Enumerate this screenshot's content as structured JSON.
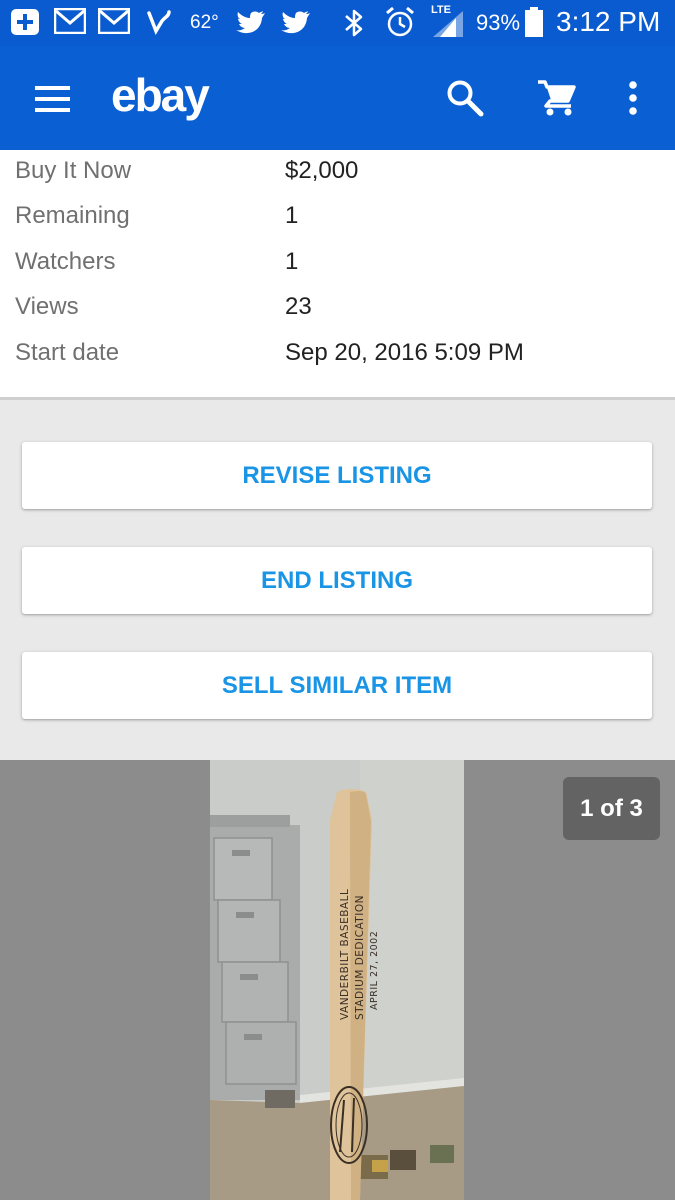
{
  "status_bar": {
    "temperature": "62°",
    "network": "LTE",
    "battery": "93%",
    "time": "3:12 PM",
    "icons": [
      "add-icon",
      "gmail-icon",
      "gmail-icon",
      "vine-icon",
      "twitter-icon",
      "twitter-icon",
      "bluetooth-icon",
      "alarm-icon",
      "signal-icon",
      "battery-icon"
    ]
  },
  "app_bar": {
    "logo": "ebay",
    "icons": [
      "menu-icon",
      "search-icon",
      "cart-icon",
      "more-icon"
    ]
  },
  "details": [
    {
      "label": "Buy It Now",
      "value": "$2,000"
    },
    {
      "label": "Remaining",
      "value": "1"
    },
    {
      "label": "Watchers",
      "value": "1"
    },
    {
      "label": "Views",
      "value": "23"
    },
    {
      "label": "Start date",
      "value": "Sep 20, 2016 5:09 PM"
    }
  ],
  "actions": {
    "revise": "REVISE LISTING",
    "end": "END LISTING",
    "sell_similar": "SELL SIMILAR ITEM"
  },
  "gallery": {
    "counter": "1 of 3",
    "bat_text": [
      "VANDERBILT BASEBALL",
      "STADIUM DEDICATION",
      "APRIL 27, 2002"
    ]
  },
  "colors": {
    "app_bar": "#0a5fd3",
    "status_bar": "#0b5bd0",
    "button_text": "#1a95e6",
    "background": "#e9e9e9"
  }
}
